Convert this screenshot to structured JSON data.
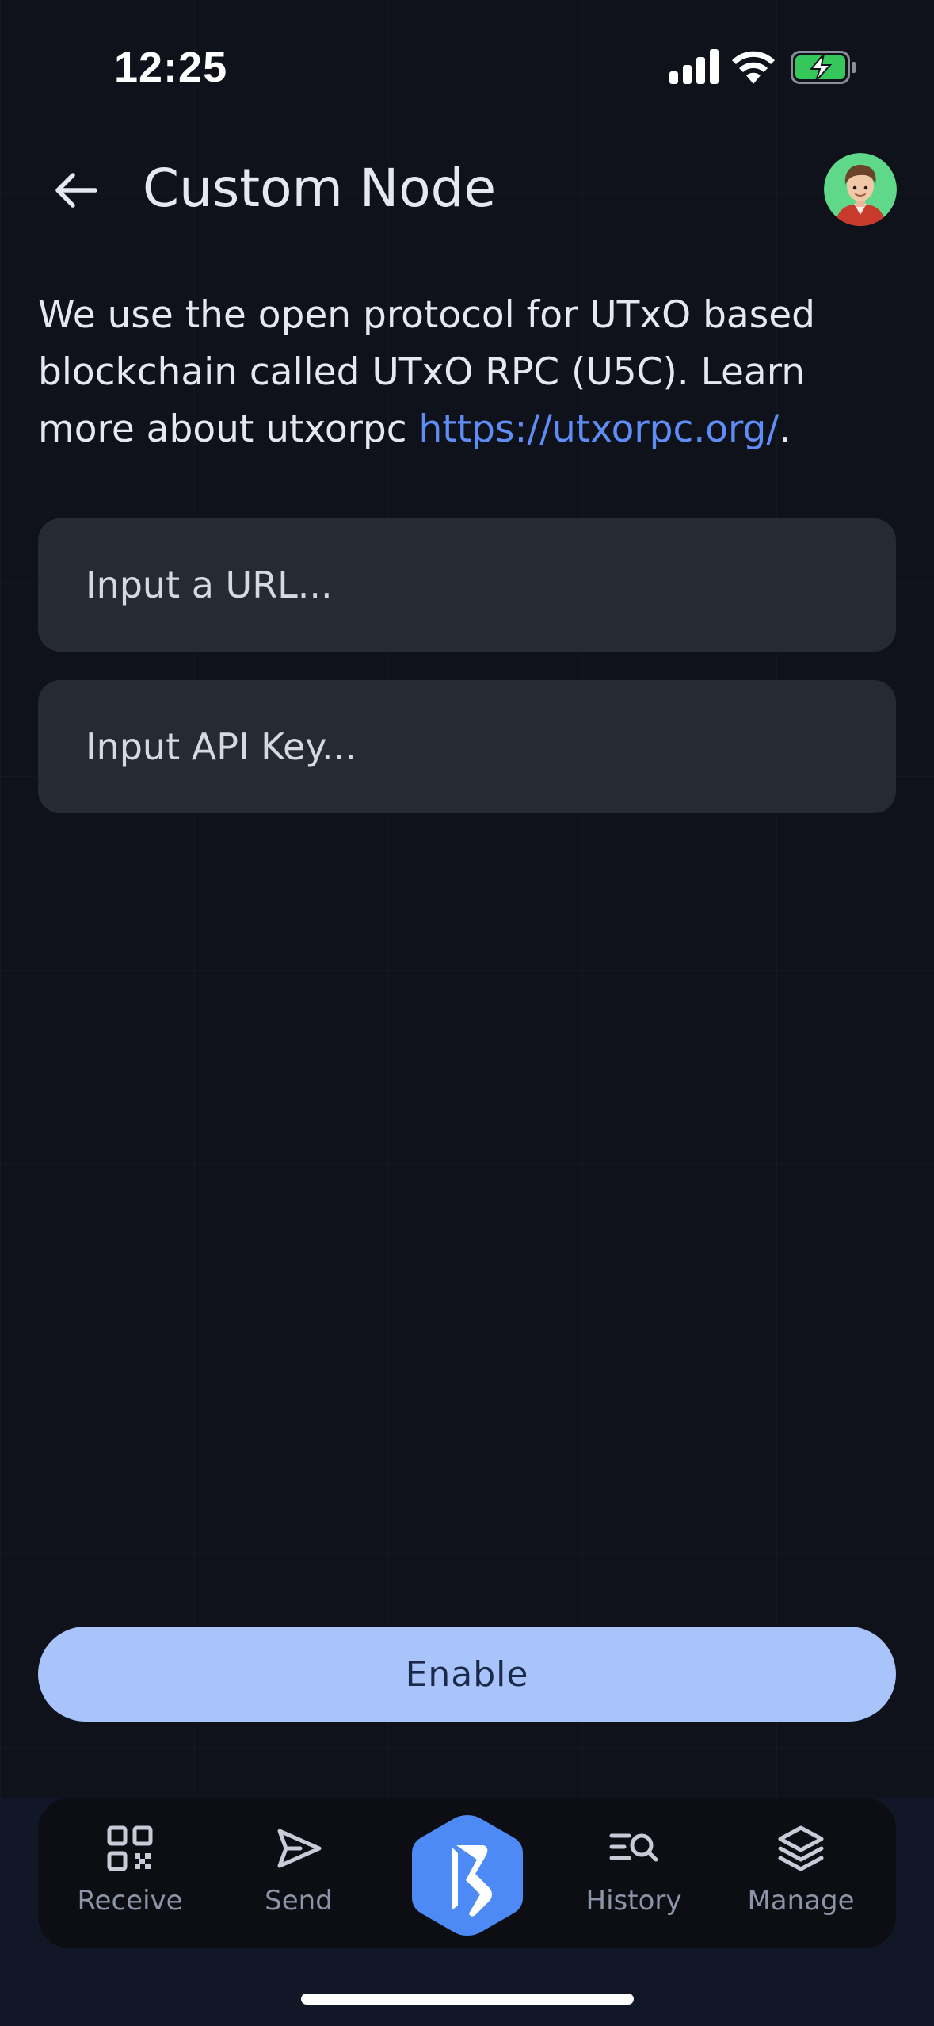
{
  "status_bar": {
    "time": "12:25",
    "icons": [
      "cellular-signal-icon",
      "wifi-icon",
      "battery-charging-icon"
    ]
  },
  "header": {
    "title": "Custom Node",
    "back_icon": "arrow-left-icon",
    "avatar_icon": "user-avatar"
  },
  "description": {
    "text": "We use the open protocol for UTxO based blockchain called UTxO RPC (U5C). Learn more about utxorpc ",
    "link": "https://utxorpc.org/",
    "suffix": "."
  },
  "form": {
    "url_placeholder": "Input a URL...",
    "url_value": "",
    "api_key_placeholder": "Input API Key...",
    "api_key_value": ""
  },
  "enable_label": "Enable",
  "nav": {
    "items": [
      {
        "label": "Receive",
        "icon": "qr-code-icon"
      },
      {
        "label": "Send",
        "icon": "send-icon"
      },
      {
        "label": "",
        "icon": "app-logo-icon"
      },
      {
        "label": "History",
        "icon": "history-search-icon"
      },
      {
        "label": "Manage",
        "icon": "layers-icon"
      }
    ]
  },
  "colors": {
    "background": "#0f121b",
    "input_bg": "#262a33",
    "link": "#5e8ef5",
    "button": "#a9c3fb",
    "button_text": "#1b2a4a",
    "brand": "#4d8af5"
  }
}
